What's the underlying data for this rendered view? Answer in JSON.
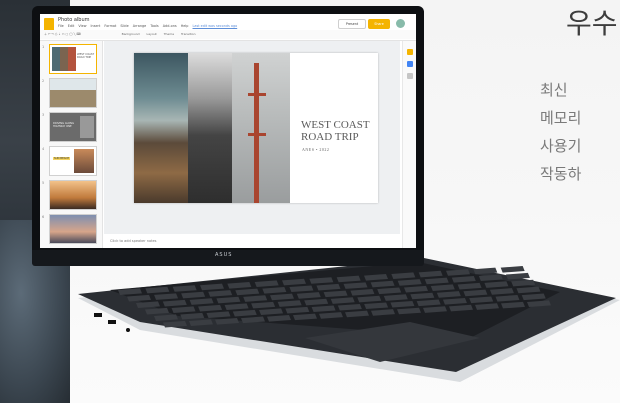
{
  "hero": {
    "headline": "우수",
    "body_lines": [
      "최신",
      "메모리",
      "사용기",
      "작동하"
    ]
  },
  "laptop": {
    "brand": "ASUS",
    "app": {
      "doc_title": "Photo album",
      "menu_items": [
        "File",
        "Edit",
        "View",
        "Insert",
        "Format",
        "Slide",
        "Arrange",
        "Tools",
        "Add-ons",
        "Help"
      ],
      "last_edit": "Last edit was seconds ago",
      "present_label": "Present",
      "share_label": "Share",
      "toolbar_labels": [
        "Background",
        "Layout",
        "Theme",
        "Transition"
      ],
      "notes_placeholder": "Click to add speaker notes",
      "slide": {
        "title": "WEST COAST ROAD TRIP",
        "subtitle": "ANES • 2022"
      },
      "thumbnails": [
        {
          "num": "1",
          "label": "WEST COAST ROAD TRIP"
        },
        {
          "num": "2",
          "label": ""
        },
        {
          "num": "3",
          "label": "DRIVING ALONG HIGHWAY ONE"
        },
        {
          "num": "4",
          "label": "SUN BEACH"
        },
        {
          "num": "5",
          "label": ""
        },
        {
          "num": "6",
          "label": ""
        }
      ]
    }
  },
  "colors": {
    "accent": "#f4b400",
    "bezel": "#0d0f12",
    "deck": "#2b2e33",
    "silver": "#d9dcdf"
  }
}
